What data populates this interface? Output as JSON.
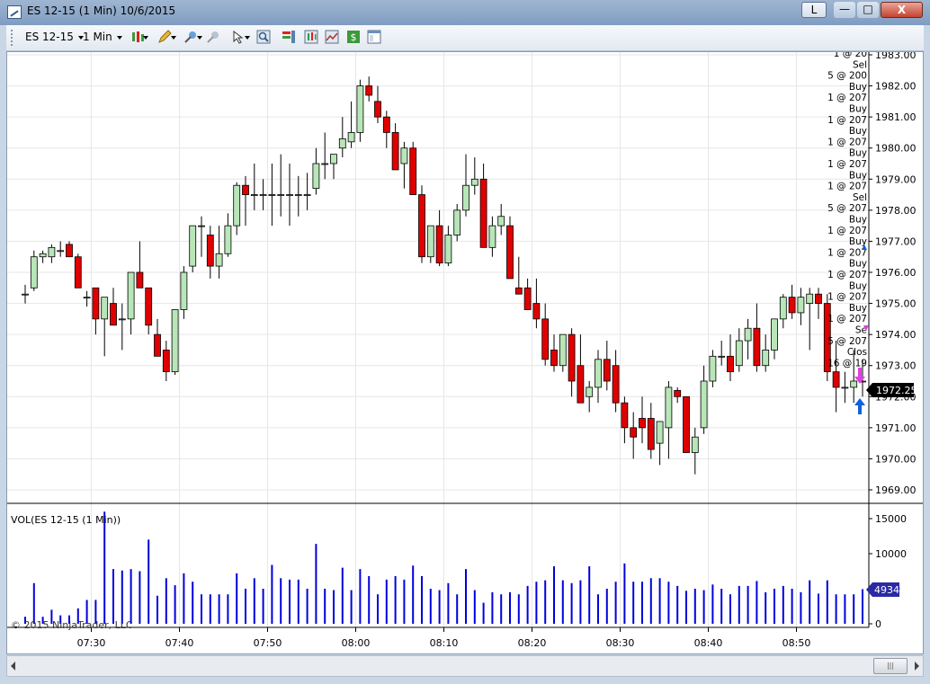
{
  "window": {
    "title": "ES 12-15 (1 Min)  10/6/2015",
    "l_button": "L",
    "min_label": "—",
    "max_label": "□",
    "close_label": "X"
  },
  "toolbar": {
    "instrument": "ES 12-15",
    "interval": "1 Min"
  },
  "colors": {
    "up_candle": "#b8e6b8",
    "down_candle": "#e00000",
    "volume": "#0000dd",
    "price_tag": "#000000",
    "volume_tag": "#2a2aa6",
    "sell_arrow": "#e040e0",
    "buy_arrow": "#1060e0"
  },
  "price_axis": {
    "ticks": [
      "1983.00",
      "1982.00",
      "1981.00",
      "1980.00",
      "1979.00",
      "1978.00",
      "1977.00",
      "1976.00",
      "1975.00",
      "1974.00",
      "1973.00",
      "1972.00",
      "1971.00",
      "1970.00",
      "1969.00"
    ],
    "last_price": "1972.25"
  },
  "volume_panel": {
    "label": "VOL(ES 12-15 (1 Min))",
    "ticks": [
      "15000",
      "10000",
      "5000",
      "0"
    ],
    "last_volume": "4934"
  },
  "time_axis": {
    "ticks": [
      "07:30",
      "07:40",
      "07:50",
      "08:00",
      "08:10",
      "08:20",
      "08:30",
      "08:40",
      "08:50"
    ]
  },
  "copyright": "© 2015 NinjaTrader, LLC",
  "trade_annotations": [
    "1 @ 20",
    "Sel",
    "5 @ 200",
    "Buy",
    "1 @ 207",
    "Buy",
    "1 @ 207",
    "Buy",
    "1 @ 207",
    "Buy",
    "1 @ 207",
    "Buy",
    "1 @ 207",
    "Sel",
    "5 @ 207",
    "Buy",
    "1 @ 207",
    "Buy",
    "1 @ 207",
    "Buy",
    "1 @ 207",
    "Buy",
    "1 @ 207",
    "Buy",
    "1 @ 207",
    "Se",
    "5 @ 207",
    "Clos",
    "16 @ 19"
  ],
  "chart_data": {
    "type": "candlestick",
    "instrument": "ES 12-15",
    "interval": "1 Min",
    "x_ticks": [
      "07:30",
      "07:40",
      "07:50",
      "08:00",
      "08:10",
      "08:20",
      "08:30",
      "08:40",
      "08:50"
    ],
    "ylim": [
      1968.75,
      1983.1
    ],
    "volume_ylim": [
      0,
      16500
    ],
    "candles": [
      {
        "o": 1975.3,
        "h": 1975.6,
        "l": 1975.0,
        "c": 1975.3,
        "v": 1000
      },
      {
        "o": 1975.5,
        "h": 1976.7,
        "l": 1975.4,
        "c": 1976.5,
        "v": 5800
      },
      {
        "o": 1976.5,
        "h": 1976.7,
        "l": 1976.3,
        "c": 1976.6,
        "v": 1000
      },
      {
        "o": 1976.5,
        "h": 1976.9,
        "l": 1976.3,
        "c": 1976.8,
        "v": 2000
      },
      {
        "o": 1976.7,
        "h": 1977.0,
        "l": 1976.5,
        "c": 1976.7,
        "v": 1200
      },
      {
        "o": 1976.9,
        "h": 1977.0,
        "l": 1976.5,
        "c": 1976.5,
        "v": 1200
      },
      {
        "o": 1976.5,
        "h": 1976.6,
        "l": 1975.5,
        "c": 1975.5,
        "v": 2200
      },
      {
        "o": 1975.2,
        "h": 1975.4,
        "l": 1974.9,
        "c": 1975.2,
        "v": 3400
      },
      {
        "o": 1975.5,
        "h": 1975.5,
        "l": 1974.0,
        "c": 1974.5,
        "v": 3400
      },
      {
        "o": 1974.5,
        "h": 1975.0,
        "l": 1973.3,
        "c": 1975.2,
        "v": 16000
      },
      {
        "o": 1975.0,
        "h": 1975.5,
        "l": 1974.5,
        "c": 1974.3,
        "v": 7800
      },
      {
        "o": 1974.5,
        "h": 1975.0,
        "l": 1973.5,
        "c": 1974.5,
        "v": 7600
      },
      {
        "o": 1974.5,
        "h": 1975.0,
        "l": 1974.0,
        "c": 1976.0,
        "v": 7800
      },
      {
        "o": 1976.0,
        "h": 1977.0,
        "l": 1975.8,
        "c": 1975.5,
        "v": 7500
      },
      {
        "o": 1975.5,
        "h": 1975.5,
        "l": 1974.0,
        "c": 1974.3,
        "v": 12000
      },
      {
        "o": 1974.0,
        "h": 1974.5,
        "l": 1973.3,
        "c": 1973.3,
        "v": 4000
      },
      {
        "o": 1973.5,
        "h": 1973.8,
        "l": 1972.5,
        "c": 1972.8,
        "v": 6500
      },
      {
        "o": 1972.8,
        "h": 1974.8,
        "l": 1972.7,
        "c": 1974.8,
        "v": 5500
      },
      {
        "o": 1974.8,
        "h": 1976.2,
        "l": 1974.5,
        "c": 1976.0,
        "v": 7200
      },
      {
        "o": 1976.2,
        "h": 1977.5,
        "l": 1976.0,
        "c": 1977.5,
        "v": 6000
      },
      {
        "o": 1977.5,
        "h": 1977.8,
        "l": 1976.5,
        "c": 1977.5,
        "v": 4200
      },
      {
        "o": 1977.2,
        "h": 1977.5,
        "l": 1975.8,
        "c": 1976.2,
        "v": 4200
      },
      {
        "o": 1976.2,
        "h": 1977.5,
        "l": 1975.8,
        "c": 1976.6,
        "v": 4200
      },
      {
        "o": 1976.6,
        "h": 1977.9,
        "l": 1976.5,
        "c": 1977.5,
        "v": 4200
      },
      {
        "o": 1977.5,
        "h": 1978.9,
        "l": 1977.2,
        "c": 1978.8,
        "v": 7200
      },
      {
        "o": 1978.8,
        "h": 1979.1,
        "l": 1977.5,
        "c": 1978.5,
        "v": 5000
      },
      {
        "o": 1978.5,
        "h": 1979.5,
        "l": 1978.0,
        "c": 1978.5,
        "v": 6500
      },
      {
        "o": 1978.5,
        "h": 1979.0,
        "l": 1978.0,
        "c": 1978.5,
        "v": 5000
      },
      {
        "o": 1978.5,
        "h": 1979.5,
        "l": 1977.5,
        "c": 1978.5,
        "v": 8400
      },
      {
        "o": 1978.5,
        "h": 1979.8,
        "l": 1977.8,
        "c": 1978.5,
        "v": 6500
      },
      {
        "o": 1978.5,
        "h": 1979.5,
        "l": 1977.5,
        "c": 1978.5,
        "v": 6300
      },
      {
        "o": 1978.5,
        "h": 1979.1,
        "l": 1977.8,
        "c": 1978.5,
        "v": 6300
      },
      {
        "o": 1978.5,
        "h": 1979.2,
        "l": 1978.0,
        "c": 1978.5,
        "v": 5000
      },
      {
        "o": 1978.7,
        "h": 1980.0,
        "l": 1978.5,
        "c": 1979.5,
        "v": 11400
      },
      {
        "o": 1979.5,
        "h": 1980.5,
        "l": 1979.0,
        "c": 1979.5,
        "v": 5000
      },
      {
        "o": 1979.5,
        "h": 1979.8,
        "l": 1979.0,
        "c": 1979.8,
        "v": 4800
      },
      {
        "o": 1980.0,
        "h": 1981.0,
        "l": 1979.7,
        "c": 1980.3,
        "v": 8000
      },
      {
        "o": 1980.2,
        "h": 1981.5,
        "l": 1980.0,
        "c": 1980.5,
        "v": 4800
      },
      {
        "o": 1980.5,
        "h": 1982.2,
        "l": 1980.2,
        "c": 1982.0,
        "v": 7800
      },
      {
        "o": 1982.0,
        "h": 1982.3,
        "l": 1981.5,
        "c": 1981.7,
        "v": 6800
      },
      {
        "o": 1981.5,
        "h": 1982.0,
        "l": 1980.8,
        "c": 1981.0,
        "v": 4200
      },
      {
        "o": 1981.0,
        "h": 1981.2,
        "l": 1980.0,
        "c": 1980.5,
        "v": 6300
      },
      {
        "o": 1980.5,
        "h": 1980.8,
        "l": 1979.3,
        "c": 1979.3,
        "v": 6800
      },
      {
        "o": 1979.5,
        "h": 1980.2,
        "l": 1978.7,
        "c": 1980.0,
        "v": 6300
      },
      {
        "o": 1980.0,
        "h": 1980.2,
        "l": 1978.5,
        "c": 1978.5,
        "v": 8300
      },
      {
        "o": 1978.5,
        "h": 1978.8,
        "l": 1976.3,
        "c": 1976.5,
        "v": 6800
      },
      {
        "o": 1976.5,
        "h": 1977.5,
        "l": 1976.3,
        "c": 1977.5,
        "v": 5000
      },
      {
        "o": 1977.5,
        "h": 1978.0,
        "l": 1976.2,
        "c": 1976.3,
        "v": 4800
      },
      {
        "o": 1976.3,
        "h": 1977.5,
        "l": 1976.2,
        "c": 1977.2,
        "v": 5800
      },
      {
        "o": 1977.2,
        "h": 1978.2,
        "l": 1977.0,
        "c": 1978.0,
        "v": 4200
      },
      {
        "o": 1978.0,
        "h": 1979.8,
        "l": 1977.8,
        "c": 1978.8,
        "v": 7800
      },
      {
        "o": 1978.8,
        "h": 1979.7,
        "l": 1978.5,
        "c": 1979.0,
        "v": 4800
      },
      {
        "o": 1979.0,
        "h": 1979.5,
        "l": 1976.8,
        "c": 1976.8,
        "v": 3000
      },
      {
        "o": 1976.8,
        "h": 1977.8,
        "l": 1976.5,
        "c": 1977.5,
        "v": 4500
      },
      {
        "o": 1977.5,
        "h": 1978.2,
        "l": 1977.2,
        "c": 1977.8,
        "v": 4200
      },
      {
        "o": 1977.5,
        "h": 1977.8,
        "l": 1975.8,
        "c": 1975.8,
        "v": 4500
      },
      {
        "o": 1975.5,
        "h": 1976.5,
        "l": 1975.5,
        "c": 1975.3,
        "v": 4200
      },
      {
        "o": 1975.5,
        "h": 1975.8,
        "l": 1974.8,
        "c": 1974.8,
        "v": 5400
      },
      {
        "o": 1975.0,
        "h": 1975.8,
        "l": 1974.2,
        "c": 1974.5,
        "v": 6000
      },
      {
        "o": 1974.5,
        "h": 1975.0,
        "l": 1973.0,
        "c": 1973.2,
        "v": 6200
      },
      {
        "o": 1973.5,
        "h": 1974.0,
        "l": 1972.8,
        "c": 1973.0,
        "v": 8200
      },
      {
        "o": 1973.0,
        "h": 1974.0,
        "l": 1972.8,
        "c": 1974.0,
        "v": 6200
      },
      {
        "o": 1974.0,
        "h": 1974.2,
        "l": 1972.0,
        "c": 1972.5,
        "v": 5800
      },
      {
        "o": 1973.0,
        "h": 1974.0,
        "l": 1971.8,
        "c": 1971.8,
        "v": 6200
      },
      {
        "o": 1972.0,
        "h": 1972.5,
        "l": 1971.5,
        "c": 1972.3,
        "v": 8200
      },
      {
        "o": 1972.3,
        "h": 1973.5,
        "l": 1971.8,
        "c": 1973.2,
        "v": 4200
      },
      {
        "o": 1973.2,
        "h": 1973.8,
        "l": 1972.2,
        "c": 1972.5,
        "v": 5000
      },
      {
        "o": 1973.0,
        "h": 1973.5,
        "l": 1971.5,
        "c": 1971.8,
        "v": 6000
      },
      {
        "o": 1971.8,
        "h": 1972.0,
        "l": 1970.5,
        "c": 1971.0,
        "v": 8600
      },
      {
        "o": 1971.0,
        "h": 1971.5,
        "l": 1970.0,
        "c": 1970.7,
        "v": 6000
      },
      {
        "o": 1971.3,
        "h": 1972.0,
        "l": 1970.5,
        "c": 1971.0,
        "v": 6000
      },
      {
        "o": 1971.3,
        "h": 1971.8,
        "l": 1970.0,
        "c": 1970.3,
        "v": 6500
      },
      {
        "o": 1970.5,
        "h": 1971.2,
        "l": 1969.8,
        "c": 1971.2,
        "v": 6500
      },
      {
        "o": 1971.0,
        "h": 1972.5,
        "l": 1970.0,
        "c": 1972.3,
        "v": 6000
      },
      {
        "o": 1972.2,
        "h": 1972.3,
        "l": 1971.8,
        "c": 1972.0,
        "v": 5400
      },
      {
        "o": 1972.0,
        "h": 1972.0,
        "l": 1970.3,
        "c": 1970.2,
        "v": 4700
      },
      {
        "o": 1970.2,
        "h": 1971.0,
        "l": 1969.5,
        "c": 1970.7,
        "v": 5000
      },
      {
        "o": 1971.0,
        "h": 1973.0,
        "l": 1970.8,
        "c": 1972.5,
        "v": 4800
      },
      {
        "o": 1972.5,
        "h": 1973.5,
        "l": 1972.3,
        "c": 1973.3,
        "v": 5600
      },
      {
        "o": 1973.3,
        "h": 1973.8,
        "l": 1973.0,
        "c": 1973.3,
        "v": 5000
      },
      {
        "o": 1973.3,
        "h": 1974.0,
        "l": 1972.5,
        "c": 1972.8,
        "v": 4200
      },
      {
        "o": 1973.0,
        "h": 1974.2,
        "l": 1972.8,
        "c": 1973.8,
        "v": 5400
      },
      {
        "o": 1973.8,
        "h": 1974.5,
        "l": 1973.2,
        "c": 1974.2,
        "v": 5400
      },
      {
        "o": 1974.2,
        "h": 1975.0,
        "l": 1972.8,
        "c": 1973.0,
        "v": 6100
      },
      {
        "o": 1973.0,
        "h": 1974.0,
        "l": 1972.8,
        "c": 1973.5,
        "v": 4500
      },
      {
        "o": 1973.5,
        "h": 1974.5,
        "l": 1973.2,
        "c": 1974.5,
        "v": 5000
      },
      {
        "o": 1974.5,
        "h": 1975.3,
        "l": 1974.2,
        "c": 1975.2,
        "v": 5400
      },
      {
        "o": 1975.2,
        "h": 1975.6,
        "l": 1974.5,
        "c": 1974.7,
        "v": 5000
      },
      {
        "o": 1974.7,
        "h": 1975.5,
        "l": 1974.3,
        "c": 1975.2,
        "v": 4500
      },
      {
        "o": 1975.0,
        "h": 1975.5,
        "l": 1973.5,
        "c": 1975.3,
        "v": 6200
      },
      {
        "o": 1975.3,
        "h": 1975.5,
        "l": 1974.5,
        "c": 1975.0,
        "v": 4300
      },
      {
        "o": 1975.0,
        "h": 1975.3,
        "l": 1972.5,
        "c": 1972.8,
        "v": 6200
      },
      {
        "o": 1972.8,
        "h": 1973.8,
        "l": 1971.5,
        "c": 1972.3,
        "v": 4200
      },
      {
        "o": 1972.3,
        "h": 1972.8,
        "l": 1971.8,
        "c": 1972.3,
        "v": 4200
      },
      {
        "o": 1972.3,
        "h": 1973.5,
        "l": 1971.8,
        "c": 1972.5,
        "v": 4200
      },
      {
        "o": 1972.5,
        "h": 1973.2,
        "l": 1972.0,
        "c": 1972.5,
        "v": 4934
      }
    ]
  }
}
